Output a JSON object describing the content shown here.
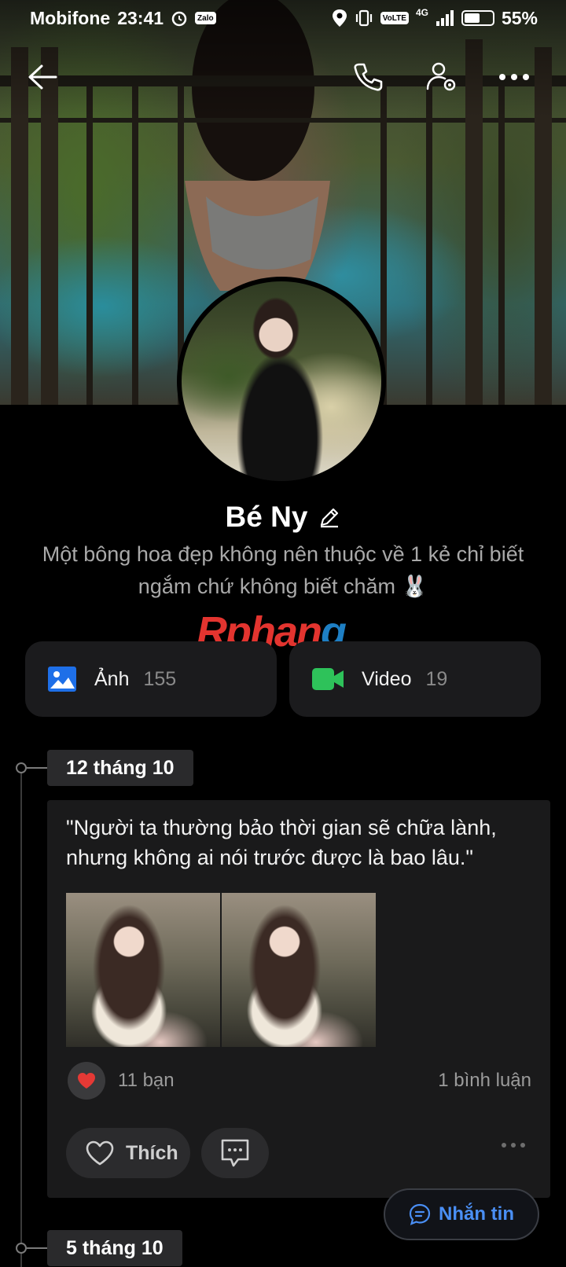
{
  "status_bar": {
    "carrier": "Mobifone",
    "time": "23:41",
    "app_badge": "Zalo",
    "volte": "VoLTE",
    "network": "4G",
    "battery": "55%",
    "battery_level": 0.55
  },
  "top_nav": {
    "icons": [
      "back-arrow-icon",
      "phone-icon",
      "user-settings-icon",
      "more-icon"
    ]
  },
  "profile": {
    "name": "Bé Ny",
    "bio": "Một bông hoa đẹp không nên thuộc về 1 kẻ chỉ biết ngắm chứ không biết chăm 🐰"
  },
  "watermark": {
    "text_main": "Rphan",
    "text_tail": "g"
  },
  "media": {
    "photos": {
      "label": "Ảnh",
      "count": "155",
      "icon": "image-icon",
      "color": "#1e6fe8"
    },
    "videos": {
      "label": "Video",
      "count": "19",
      "icon": "video-camera-icon",
      "color": "#2ec25a"
    }
  },
  "timeline": [
    {
      "date": "12 tháng 10",
      "quote": "\"Người ta thường bảo thời gian sẽ chữa lành, nhưng không ai nói trước được là bao lâu.\"",
      "photos_count": 2,
      "reaction_icon": "heart-icon",
      "reactions": "11 bạn",
      "comments": "1 bình luận",
      "like_label": "Thích"
    },
    {
      "date": "5 tháng 10"
    }
  ],
  "message_button": {
    "label": "Nhắn tin",
    "icon": "chat-bubble-icon",
    "color": "#4a8ff5"
  }
}
